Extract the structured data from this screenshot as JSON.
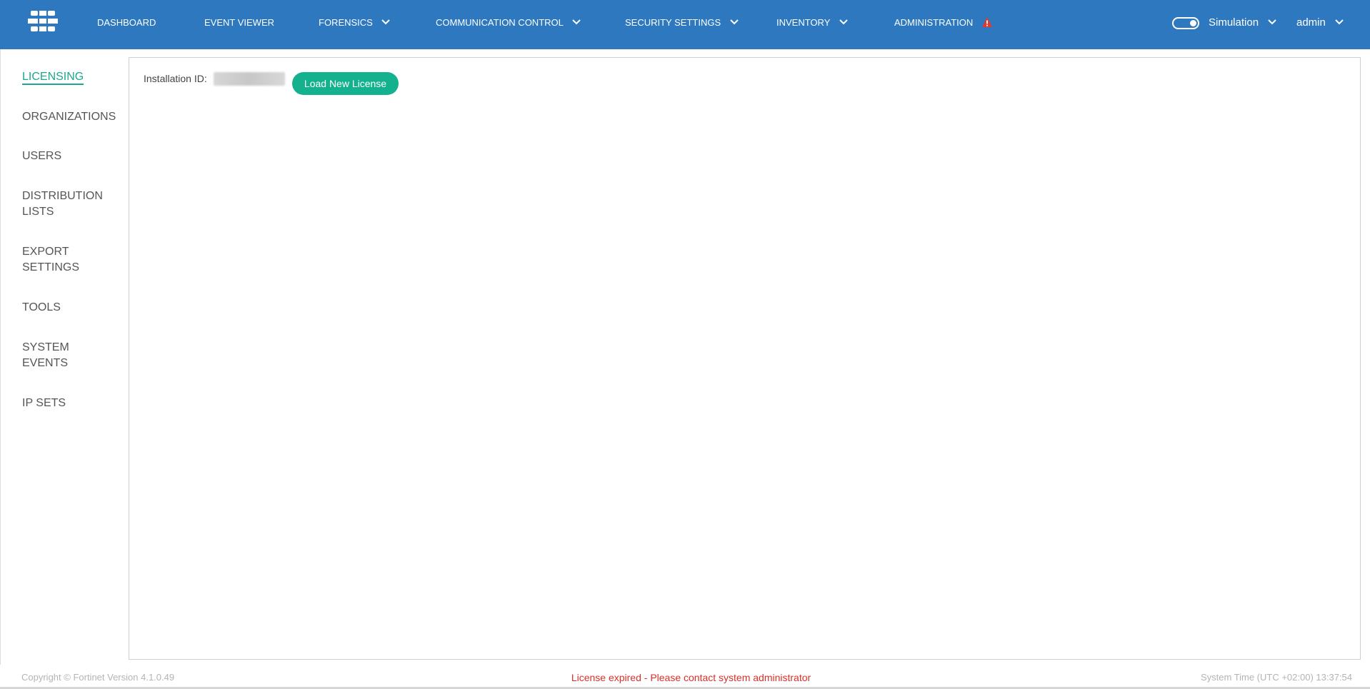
{
  "nav": {
    "items": [
      {
        "label": "DASHBOARD"
      },
      {
        "label": "EVENT VIEWER"
      },
      {
        "label": "FORENSICS"
      },
      {
        "label": "COMMUNICATION CONTROL"
      },
      {
        "label": "SECURITY SETTINGS"
      },
      {
        "label": "INVENTORY"
      },
      {
        "label": "ADMINISTRATION"
      }
    ],
    "mode_label": "Simulation",
    "user_label": "admin",
    "colors": {
      "bar": "#2e78c0",
      "warning": "#e0382b"
    }
  },
  "sidebar": {
    "items": [
      {
        "label": "LICENSING"
      },
      {
        "label": "ORGANIZATIONS"
      },
      {
        "label": "USERS"
      },
      {
        "label": "DISTRIBUTION LISTS"
      },
      {
        "label": "EXPORT SETTINGS"
      },
      {
        "label": "TOOLS"
      },
      {
        "label": "SYSTEM EVENTS"
      },
      {
        "label": "IP SETS"
      }
    ],
    "active": "LICENSING",
    "accent_color": "#1aa88f"
  },
  "licensing": {
    "installation_label": "Installation ID:",
    "load_button_label": "Load New License",
    "button_color": "#14b18e"
  },
  "footer": {
    "copyright": "Copyright © Fortinet Version 4.1.0.49",
    "license_message": "License expired - Please contact system administrator",
    "system_time": "System Time (UTC +02:00) 13:37:54"
  }
}
